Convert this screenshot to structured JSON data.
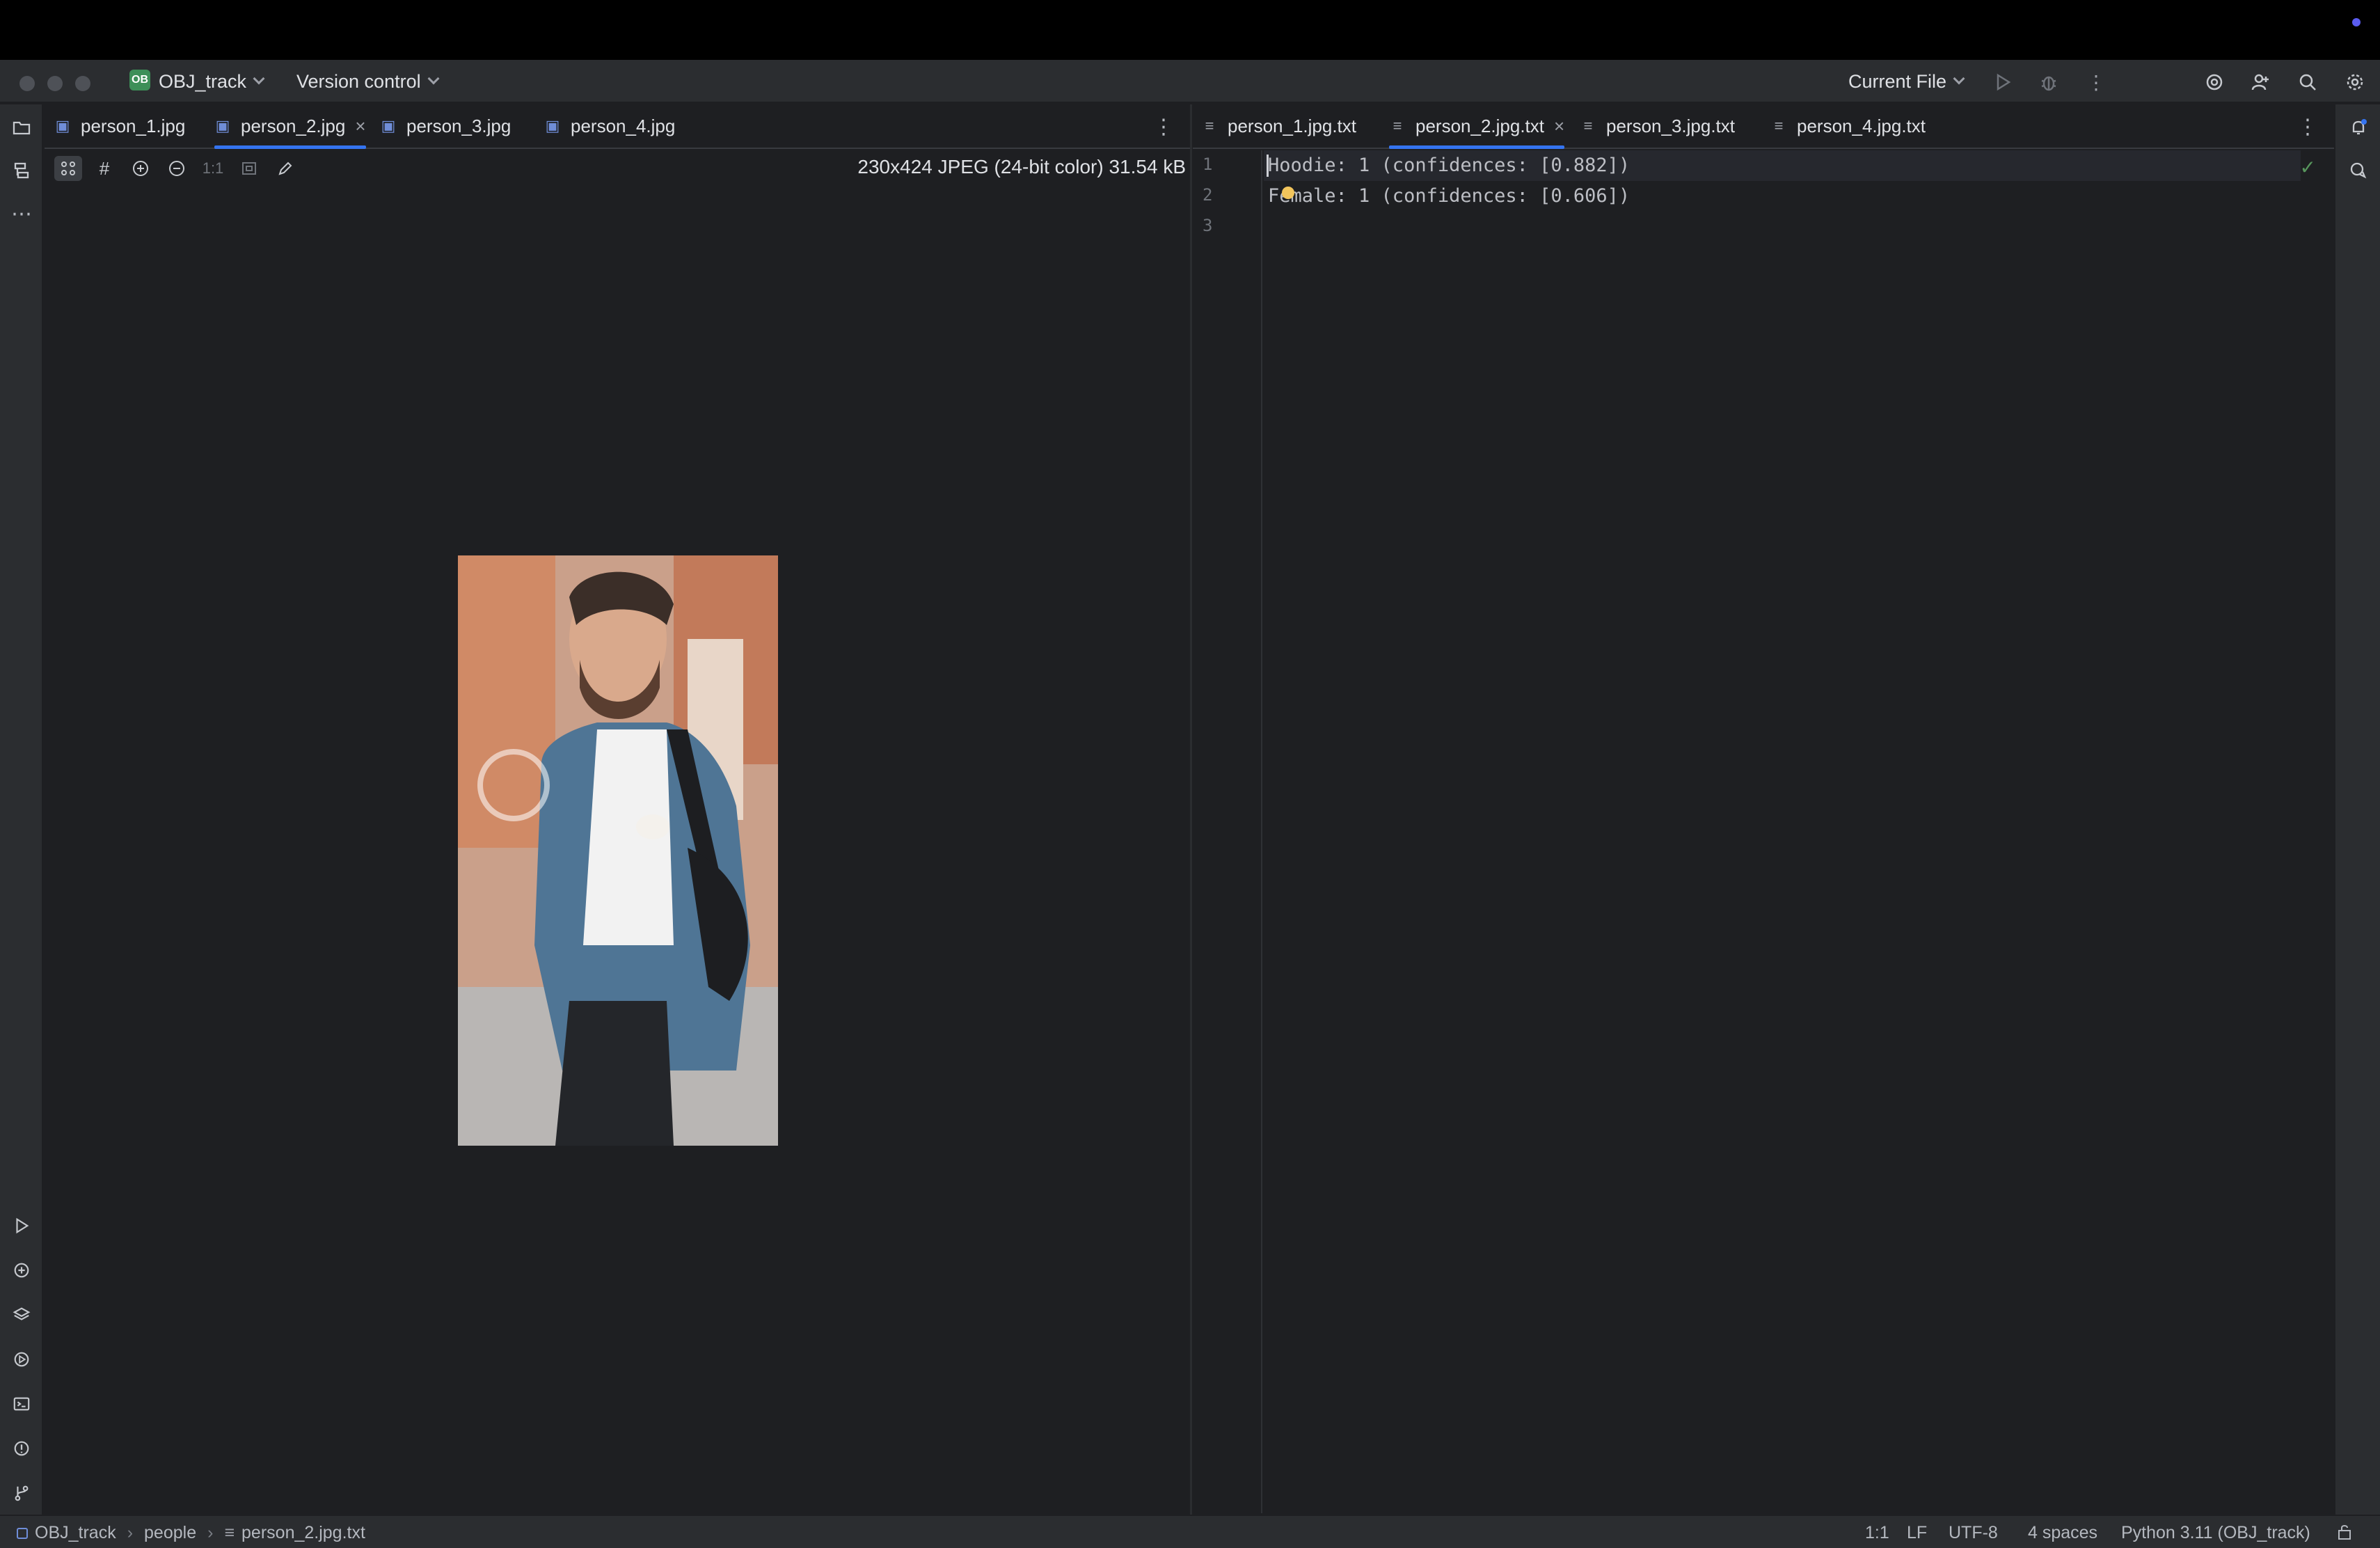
{
  "titlebar": {
    "project_badge": "OB",
    "project_name": "OBJ_track",
    "vcs": "Version control",
    "run_config": "Current File"
  },
  "left_tabs": [
    {
      "label": "person_1.jpg"
    },
    {
      "label": "person_2.jpg",
      "active": true
    },
    {
      "label": "person_3.jpg"
    },
    {
      "label": "person_4.jpg"
    }
  ],
  "right_tabs": [
    {
      "label": "person_1.jpg.txt"
    },
    {
      "label": "person_2.jpg.txt",
      "active": true
    },
    {
      "label": "person_3.jpg.txt"
    },
    {
      "label": "person_4.jpg.txt"
    }
  ],
  "image_viewer": {
    "zoom_actual": "1:1",
    "info": "230x424 JPEG (24-bit color) 31.54 kB"
  },
  "editor": {
    "line_numbers": [
      "1",
      "2",
      "3"
    ],
    "lines": [
      "Hoodie: 1 (confidences: [0.882])",
      "Female: 1 (confidences: [0.606])",
      ""
    ]
  },
  "statusbar": {
    "breadcrumb": [
      "OBJ_track",
      "people",
      "person_2.jpg.txt"
    ],
    "position": "1:1",
    "line_sep": "LF",
    "encoding": "UTF-8",
    "indent": "4 spaces",
    "interpreter": "Python 3.11 (OBJ_track)"
  },
  "colors": {
    "accent": "#3574f0",
    "background": "#1e1f22",
    "panel": "#2b2d30"
  }
}
